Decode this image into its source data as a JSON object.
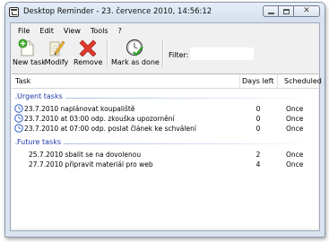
{
  "window": {
    "title": "Desktop Reminder - 23. července 2010, 14:56:12",
    "buttons": {
      "minimize_icon": "minimize-icon",
      "maximize_icon": "maximize-icon",
      "close_icon": "close-icon",
      "close_glyph": "✕"
    }
  },
  "menu": [
    "File",
    "Edit",
    "View",
    "Tools",
    "?"
  ],
  "toolbar": {
    "new_task": "New task",
    "modify": "Modify",
    "remove": "Remove",
    "mark_as_done": "Mark as done",
    "filter_label": "Filter:",
    "filter_value": ""
  },
  "list": {
    "columns": {
      "task": "Task",
      "days_left": "Days left",
      "scheduled": "Scheduled"
    },
    "groups": [
      {
        "label": "Urgent tasks",
        "rows": [
          {
            "task": "23.7.2010 naplánovat koupaliště",
            "days_left": "0",
            "scheduled": "Once",
            "icon": "clock-icon"
          },
          {
            "task": "23.7.2010 at 03:00 odp. zkouška upozornění",
            "days_left": "0",
            "scheduled": "Once",
            "icon": "clock-icon"
          },
          {
            "task": "23.7.2010 at 07:00 odp. poslat článek ke schválení",
            "days_left": "0",
            "scheduled": "Once",
            "icon": "clock-icon"
          }
        ]
      },
      {
        "label": "Future tasks",
        "rows": [
          {
            "task": "25.7.2010 sbalit se na dovolenou",
            "days_left": "2",
            "scheduled": "Once"
          },
          {
            "task": "27.7.2010 připravit materiál pro web",
            "days_left": "4",
            "scheduled": "Once"
          }
        ]
      }
    ]
  },
  "colors": {
    "group_label": "#1e39a8",
    "window_frame": "#d9e4f1",
    "clock_blue": "#2f5fc4"
  }
}
